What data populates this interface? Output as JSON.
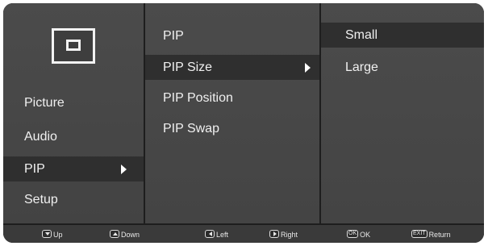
{
  "main_menu": {
    "icon": "pip-icon",
    "items": [
      {
        "label": "Picture",
        "selected": false
      },
      {
        "label": "Audio",
        "selected": false
      },
      {
        "label": "PIP",
        "selected": true
      },
      {
        "label": "Setup",
        "selected": false
      }
    ]
  },
  "submenu": {
    "items": [
      {
        "label": "PIP",
        "selected": false
      },
      {
        "label": "PIP Size",
        "selected": true
      },
      {
        "label": "PIP Position",
        "selected": false
      },
      {
        "label": "PIP Swap",
        "selected": false
      }
    ]
  },
  "options": {
    "items": [
      {
        "label": "Small",
        "selected": true
      },
      {
        "label": "Large",
        "selected": false
      }
    ]
  },
  "footer": {
    "hints": [
      {
        "icon": "down-key-icon",
        "key": "",
        "label": "Up"
      },
      {
        "icon": "up-key-icon",
        "key": "",
        "label": "Down"
      },
      {
        "icon": "left-key-icon",
        "key": "",
        "label": "Left"
      },
      {
        "icon": "right-key-icon",
        "key": "",
        "label": "Right"
      },
      {
        "icon": "ok-key-icon",
        "key": "OK",
        "label": "OK"
      },
      {
        "icon": "exit-key-icon",
        "key": "EXIT",
        "label": "Return"
      }
    ]
  },
  "colors": {
    "panel": "#4a4a4a",
    "selected_row": "#2f2f2f",
    "text": "#f0f0f0"
  }
}
